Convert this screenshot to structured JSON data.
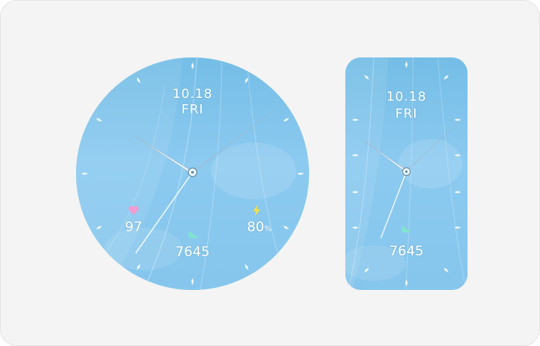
{
  "round_face": {
    "date": "10.18",
    "day": "FRI",
    "heart_rate": "97",
    "battery_value": "80",
    "battery_unit": "%",
    "steps": "7645",
    "colors": {
      "heart": "#f29bd0",
      "battery": "#f3e24a",
      "steps": "#7fe3cf"
    }
  },
  "band_face": {
    "date": "10.18",
    "day": "FRI",
    "steps": "7645",
    "colors": {
      "steps": "#7fe3cf"
    }
  },
  "icons": [
    "heart-icon",
    "lightning-icon",
    "shoe-icon"
  ]
}
